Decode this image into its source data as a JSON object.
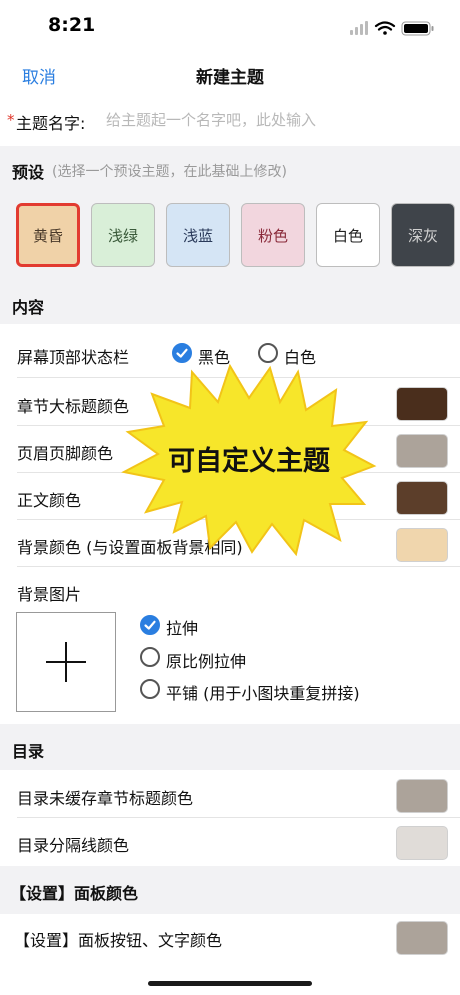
{
  "status": {
    "time": "8:21"
  },
  "nav": {
    "cancel": "取消",
    "title": "新建主题"
  },
  "name_field": {
    "required_mark": "*",
    "label": "主题名字:",
    "placeholder": "给主题起一个名字吧，此处输入",
    "value": ""
  },
  "preset_section": {
    "title": "预设",
    "hint": "(选择一个预设主题，在此基础上修改)"
  },
  "presets": [
    {
      "label": "黄昏",
      "bg": "#f0d2a8",
      "fg": "#4a3a2a",
      "selected": true
    },
    {
      "label": "浅绿",
      "bg": "#d9efd8",
      "fg": "#3a5a3a",
      "selected": false
    },
    {
      "label": "浅蓝",
      "bg": "#d5e5f5",
      "fg": "#2a3a5a",
      "selected": false
    },
    {
      "label": "粉色",
      "bg": "#f2d6de",
      "fg": "#8a2a3a",
      "selected": false
    },
    {
      "label": "白色",
      "bg": "#ffffff",
      "fg": "#222222",
      "selected": false
    },
    {
      "label": "深灰",
      "bg": "#3f444a",
      "fg": "#d0d0d0",
      "selected": false
    }
  ],
  "content_section": {
    "title": "内容"
  },
  "status_bar_row": {
    "label": "屏幕顶部状态栏",
    "option_black": "黑色",
    "option_white": "白色",
    "selected": "黑色"
  },
  "color_rows": [
    {
      "label": "章节大标题颜色",
      "color": "#4a2e1c"
    },
    {
      "label": "页眉页脚颜色",
      "color": "#aca39a"
    },
    {
      "label": "正文颜色",
      "color": "#5c3e2a"
    },
    {
      "label": "背景颜色 (与设置面板背景相同)",
      "color": "#f0d6ad"
    }
  ],
  "bg_image": {
    "label": "背景图片",
    "options": [
      {
        "label": "拉伸",
        "checked": true
      },
      {
        "label": "原比例拉伸",
        "checked": false
      },
      {
        "label": "平铺 (用于小图块重复拼接)",
        "checked": false
      }
    ]
  },
  "toc_section": {
    "title": "目录"
  },
  "toc_rows": [
    {
      "label": "目录未缓存章节标题颜色",
      "color": "#aca39a"
    },
    {
      "label": "目录分隔线颜色",
      "color": "#e0dcd8"
    }
  ],
  "panel_section": {
    "title": "【设置】面板颜色"
  },
  "panel_rows": [
    {
      "label": "【设置】面板按钮、文字颜色",
      "color": "#aca39a"
    }
  ],
  "promo_burst": {
    "text": "可自定义主题",
    "color": "#f7e62a"
  },
  "colors": {
    "accent": "#2a7ee0",
    "required": "#e0362a",
    "section_bg": "#f2f2f4"
  }
}
